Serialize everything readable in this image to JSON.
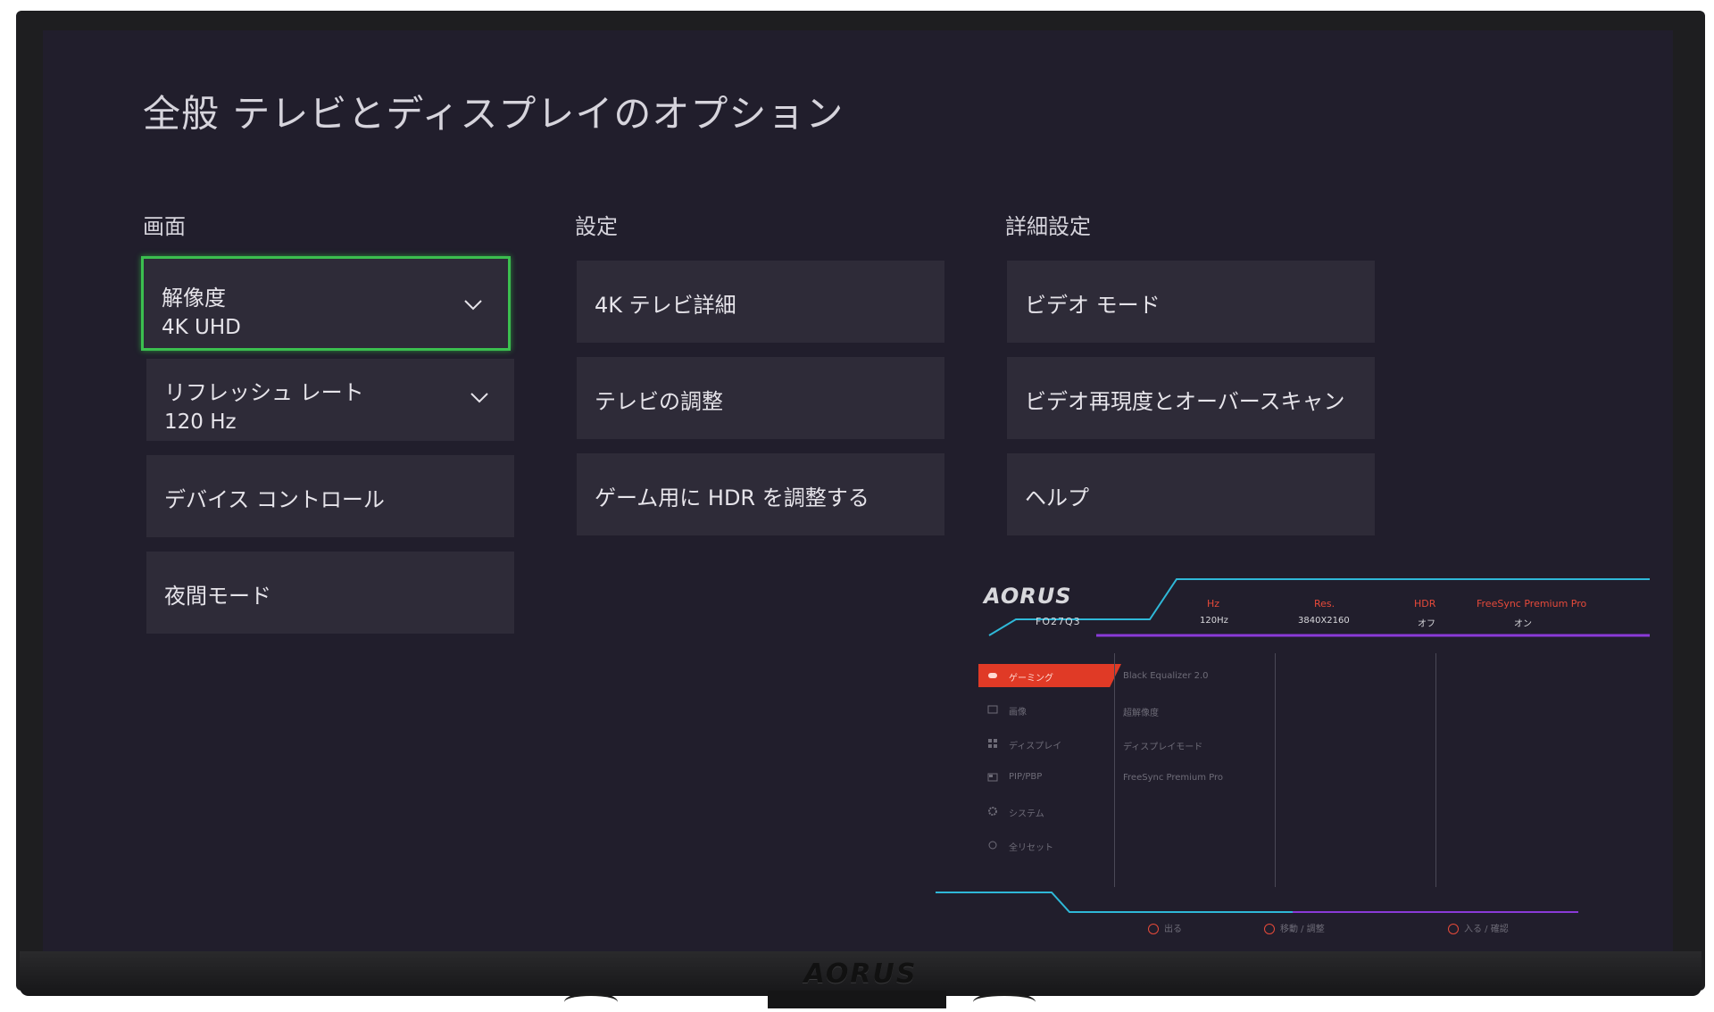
{
  "page": {
    "title": "全般 テレビとディスプレイのオプション"
  },
  "columns": [
    {
      "header": "画面",
      "tiles": [
        {
          "label": "解像度",
          "value": "4K UHD"
        },
        {
          "label": "リフレッシュ レート",
          "value": "120 Hz"
        },
        {
          "label": "デバイス コントロール"
        },
        {
          "label": "夜間モード"
        }
      ]
    },
    {
      "header": "設定",
      "tiles": [
        {
          "label": "4K テレビ詳細"
        },
        {
          "label": "テレビの調整"
        },
        {
          "label": "ゲーム用に HDR を調整する"
        }
      ]
    },
    {
      "header": "詳細設定",
      "tiles": [
        {
          "label": "ビデオ モード"
        },
        {
          "label": "ビデオ再現度とオーバースキャン"
        },
        {
          "label": "ヘルプ"
        }
      ]
    }
  ],
  "osd": {
    "brand": "AORUS",
    "model": "FO27Q3",
    "stats": [
      {
        "label": "Hz",
        "value": "120Hz"
      },
      {
        "label": "Res.",
        "value": "3840X2160"
      },
      {
        "label": "HDR",
        "value": "オフ"
      },
      {
        "label": "FreeSync Premium Pro",
        "value": "オン"
      }
    ],
    "menu": [
      {
        "label": "ゲーミング",
        "icon": "gamepad-icon"
      },
      {
        "label": "画像",
        "icon": "picture-icon"
      },
      {
        "label": "ディスプレイ",
        "icon": "display-grid-icon"
      },
      {
        "label": "PIP/PBP",
        "icon": "pip-icon"
      },
      {
        "label": "システム",
        "icon": "gear-icon"
      },
      {
        "label": "全リセット",
        "icon": "reset-icon"
      }
    ],
    "submenu": [
      "Black Equalizer 2.0",
      "超解像度",
      "ディスプレイモード",
      "FreeSync Premium Pro"
    ],
    "footer": [
      {
        "label": "出る"
      },
      {
        "label": "移動 / 調整"
      },
      {
        "label": "入る / 確認"
      }
    ]
  },
  "bezel": {
    "logo": "AORUS"
  },
  "colors": {
    "screen_bg": "#211e2c",
    "tile_bg": "#2e2b38",
    "focus_green": "#3bbf4f",
    "osd_accent": "#e03a26"
  }
}
